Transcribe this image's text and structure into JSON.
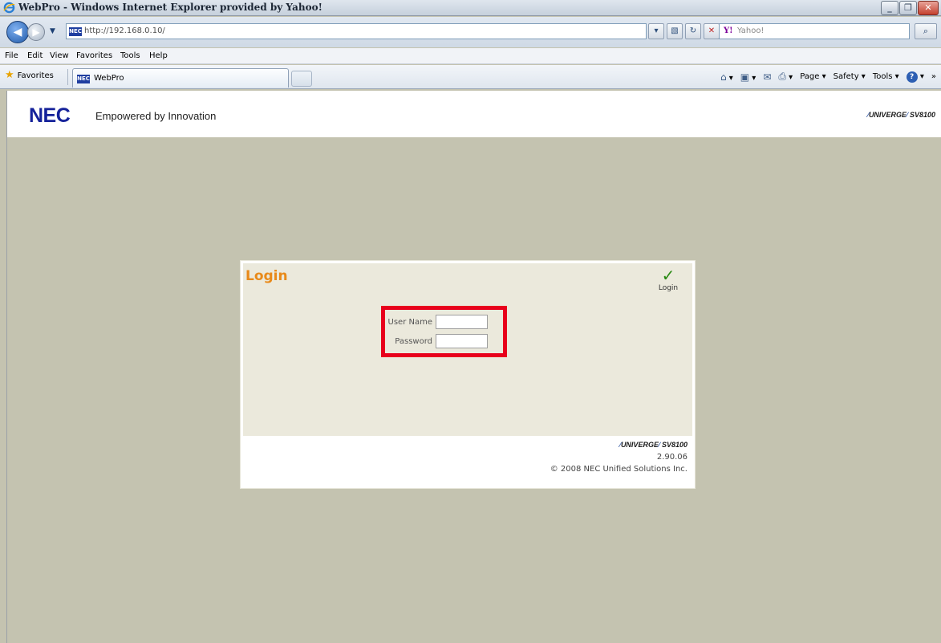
{
  "window": {
    "title": "WebPro - Windows Internet Explorer provided by Yahoo!"
  },
  "address": {
    "url": "http://192.168.0.10/",
    "search_placeholder": "Yahoo!",
    "search_provider_logo": "Y!"
  },
  "menu": {
    "items": [
      "File",
      "Edit",
      "View",
      "Favorites",
      "Tools",
      "Help"
    ]
  },
  "commandbar": {
    "favorites_label": "Favorites",
    "tab_label": "WebPro",
    "page_label": "Page",
    "safety_label": "Safety",
    "tools_label": "Tools",
    "overflow": "»"
  },
  "page": {
    "brand": "NEC",
    "tagline": "Empowered by Innovation",
    "product_logo_main": "UNIVERGE",
    "product_logo_model": "SV8100"
  },
  "login": {
    "title": "Login",
    "action_label": "Login",
    "username_label": "User Name",
    "password_label": "Password",
    "username_value": "",
    "password_value": ""
  },
  "footer": {
    "product_logo_main": "UNIVERGE",
    "product_logo_model": "SV8100",
    "version": "2.90.06",
    "copyright": "© 2008 NEC Unified Solutions Inc."
  },
  "colors": {
    "background": "#c4c3b0",
    "login_title": "#e88a1a",
    "highlight": "#e8001c",
    "nec_blue": "#15229a",
    "footer_bar": "#7a96b8"
  },
  "icons": {
    "back": "back-arrow-icon",
    "forward": "forward-arrow-icon",
    "refresh": "refresh-icon",
    "stop": "stop-icon",
    "search": "search-icon",
    "home": "home-icon",
    "feeds": "rss-feed-icon",
    "mail": "mail-icon",
    "print": "printer-icon",
    "help": "help-icon",
    "login_action": "checkmark-icon"
  }
}
